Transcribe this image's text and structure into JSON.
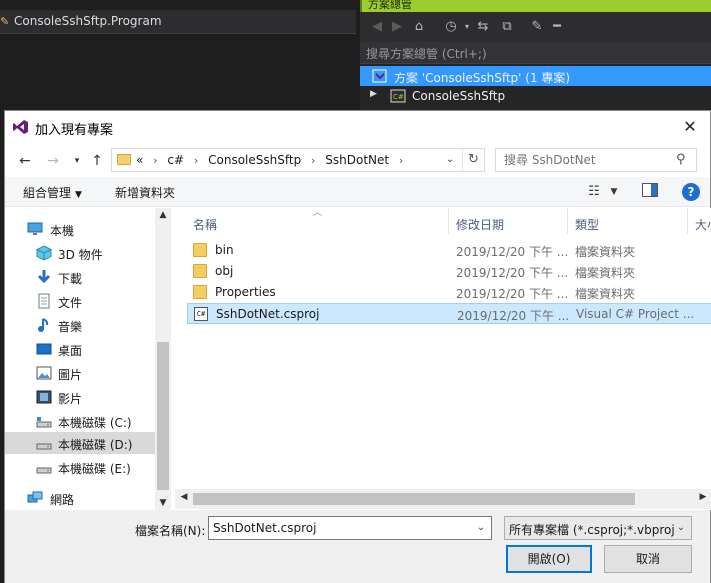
{
  "ide": {
    "editor_tab": "ConsoleSshSftp.Program",
    "solution_explorer": {
      "title": "方案總管",
      "search_placeholder": "搜尋方案總管 (Ctrl+;)",
      "solution_row": "方案 'ConsoleSshSftp' (1 專案)",
      "project_row": "ConsoleSshSftp"
    }
  },
  "dialog": {
    "title": "加入現有專案",
    "address": {
      "overflow": "«",
      "crumbs": [
        "c#",
        "ConsoleSshSftp",
        "SshDotNet"
      ]
    },
    "search_placeholder": "搜尋 SshDotNet",
    "commands": {
      "organize": "組合管理",
      "new_folder": "新增資料夾"
    },
    "nav_items": [
      {
        "label": "本機",
        "icon": "computer-icon"
      },
      {
        "label": "3D 物件",
        "icon": "3d-objects-icon"
      },
      {
        "label": "下載",
        "icon": "downloads-icon"
      },
      {
        "label": "文件",
        "icon": "documents-icon"
      },
      {
        "label": "音樂",
        "icon": "music-icon"
      },
      {
        "label": "桌面",
        "icon": "desktop-icon"
      },
      {
        "label": "圖片",
        "icon": "pictures-icon"
      },
      {
        "label": "影片",
        "icon": "videos-icon"
      },
      {
        "label": "本機磁碟 (C:)",
        "icon": "drive-icon"
      },
      {
        "label": "本機磁碟 (D:)",
        "icon": "drive-icon",
        "selected": true
      },
      {
        "label": "本機磁碟 (E:)",
        "icon": "drive-icon"
      },
      {
        "label": "網路",
        "icon": "network-icon"
      }
    ],
    "columns": [
      "名稱",
      "修改日期",
      "類型",
      "大小"
    ],
    "files": [
      {
        "name": "bin",
        "date": "2019/12/20 下午 ...",
        "type": "檔案資料夾",
        "icon": "folder-icon"
      },
      {
        "name": "obj",
        "date": "2019/12/20 下午 ...",
        "type": "檔案資料夾",
        "icon": "folder-icon"
      },
      {
        "name": "Properties",
        "date": "2019/12/20 下午 ...",
        "type": "檔案資料夾",
        "icon": "folder-icon"
      },
      {
        "name": "SshDotNet.csproj",
        "date": "2019/12/20 下午 ...",
        "type": "Visual C# Project ...",
        "icon": "csproj-icon",
        "selected": true
      }
    ],
    "filename_label": "檔案名稱(N):",
    "filename_value": "SshDotNet.csproj",
    "filter_value": "所有專案檔 (*.csproj;*.vbproj;*",
    "open_button": "開啟(O)",
    "cancel_button": "取消"
  },
  "colors": {
    "accent": "#0078d7",
    "selection": "#cce8ff",
    "se_selection": "#3399ff",
    "se_title": "#9bcc30"
  }
}
